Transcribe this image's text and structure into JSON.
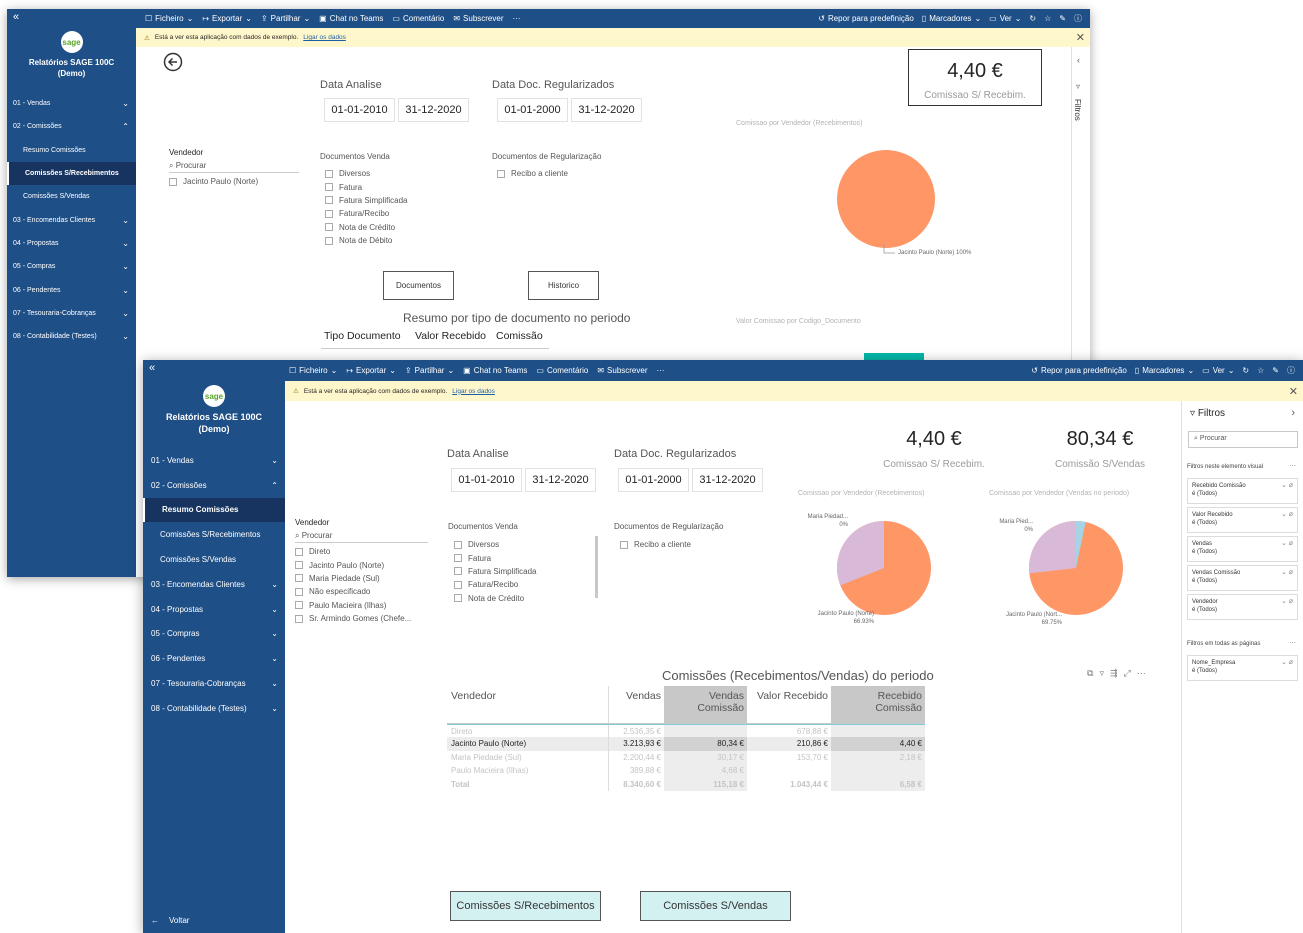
{
  "topbar": {
    "items": [
      "Ficheiro",
      "Exportar",
      "Partilhar",
      "Chat no Teams",
      "Comentário",
      "Subscrever",
      "···"
    ],
    "right": [
      "Repor para predefinição",
      "Marcadores",
      "Ver"
    ]
  },
  "warning": {
    "text": "Está a ver esta aplicação com dados de exemplo.",
    "link": "Ligar os dados"
  },
  "sidebar": {
    "app_title_1": "Relatórios SAGE 100C",
    "app_title_2": "(Demo)",
    "logo": "sage",
    "back": "Voltar",
    "nav": [
      "01 - Vendas",
      "02 - Comissões",
      "Resumo Comissões",
      "Comissões S/Recebimentos",
      "Comissões S/Vendas",
      "03 - Encomendas Clientes",
      "04 - Propostas",
      "05 - Compras",
      "06 - Pendentes",
      "07 - Tesouraria-Cobranças",
      "08 - Contabilidade (Testes)"
    ]
  },
  "win1": {
    "date_analise_label": "Data Analise",
    "date_analise": [
      "01-01-2010",
      "31-12-2020"
    ],
    "date_reg_label": "Data Doc. Regularizados",
    "date_reg": [
      "01-01-2000",
      "31-12-2020"
    ],
    "kpi_value": "4,40 €",
    "kpi_label": "Comissao S/ Recebim.",
    "vendedor_label": "Vendedor",
    "search": "Procurar",
    "vendedores": [
      "Jacinto Paulo (Norte)"
    ],
    "docs_venda_label": "Documentos Venda",
    "docs_venda": [
      "Diversos",
      "Fatura",
      "Fatura Simplificada",
      "Fatura/Recibo",
      "Nota de Crédito",
      "Nota de Débito"
    ],
    "docs_reg_label": "Documentos de Regularização",
    "docs_reg": [
      "Recibo a cliente"
    ],
    "btn_documentos": "Documentos",
    "btn_historico": "Historico",
    "pie_title": "Comissao por Vendedor (Recebimentos)",
    "pie_label": "Jacinto Paulo (Norte) 100%",
    "table_title": "Resumo por tipo de documento no periodo",
    "table_headers": [
      "Tipo Documento",
      "Valor Recebido",
      "Comissão"
    ],
    "chart2_title": "Valor Comissao por Codigo_Documento",
    "filtros_tab": "Filtros",
    "active_nav": "Comissões S/Recebimentos"
  },
  "win2": {
    "active_nav": "Resumo Comissões",
    "date_analise_label": "Data Analise",
    "date_analise": [
      "01-01-2010",
      "31-12-2020"
    ],
    "date_reg_label": "Data Doc. Regularizados",
    "date_reg": [
      "01-01-2000",
      "31-12-2020"
    ],
    "kpi1_value": "4,40 €",
    "kpi1_label": "Comissao S/ Recebim.",
    "kpi2_value": "80,34 €",
    "kpi2_label": "Comissão S/Vendas",
    "vendedor_label": "Vendedor",
    "search": "Procurar",
    "vendedores": [
      "Direto",
      "Jacinto Paulo (Norte)",
      "Maria Piedade (Sul)",
      "Não especificado",
      "Paulo Macieira (Ilhas)",
      "Sr. Armindo Gomes (Chefe..."
    ],
    "docs_venda_label": "Documentos Venda",
    "docs_venda": [
      "Diversos",
      "Fatura",
      "Fatura Simplificada",
      "Fatura/Recibo",
      "Nota de Crédito"
    ],
    "docs_reg_label": "Documentos de Regularização",
    "docs_reg": [
      "Recibo a cliente"
    ],
    "pie1_title": "Comissao por Vendedor (Recebimentos)",
    "pie1_maria": "Maria Piedad...",
    "pie1_maria_pct": "0%",
    "pie1_jacinto": "Jacinto Paulo (Norte)",
    "pie1_jacinto_pct": "66.93%",
    "pie2_title": "Comissao por Vendedor (Vendas no periodo)",
    "pie2_maria": "Maria Pied...",
    "pie2_maria_pct": "0%",
    "pie2_jacinto": "Jacinto Paulo (Nort...",
    "pie2_jacinto_pct": "69.75%",
    "matrix_title": "Comissões (Recebimentos/Vendas) do periodo",
    "matrix_headers": [
      "Vendedor",
      "Vendas",
      "Vendas Comissão",
      "Valor Recebido",
      "Recebido Comissão"
    ],
    "matrix_rows": [
      [
        "Direto",
        "2.536,35 €",
        "",
        "678,88 €",
        ""
      ],
      [
        "Jacinto Paulo (Norte)",
        "3.213,93 €",
        "80,34 €",
        "210,86 €",
        "4,40 €"
      ],
      [
        "Maria Piedade (Sul)",
        "2.200,44 €",
        "30,17 €",
        "153,70 €",
        "2,18 €"
      ],
      [
        "Paulo Macieira (Ilhas)",
        "389,88 €",
        "4,68 €",
        "",
        ""
      ],
      [
        "Total",
        "8.340,60 €",
        "115,18 €",
        "1.043,44 €",
        "6,58 €"
      ]
    ],
    "btn_receb": "Comissões S/Recebimentos",
    "btn_vendas": "Comissões S/Vendas",
    "filters": {
      "title": "Filtros",
      "search": "Procurar",
      "visual_header": "Filtros neste elemento visual",
      "visual_cards": [
        [
          "Recebido Comissão",
          "é (Todos)"
        ],
        [
          "Valor Recebido",
          "é (Todos)"
        ],
        [
          "Vendas",
          "é (Todos)"
        ],
        [
          "Vendas Comissão",
          "é (Todos)"
        ],
        [
          "Vendedor",
          "é (Todos)"
        ]
      ],
      "pages_header": "Filtros em todas as páginas",
      "pages_cards": [
        [
          "Nome_Empresa",
          "é (Todos)"
        ]
      ]
    }
  },
  "colors": {
    "brand": "#1f4f87",
    "pie_orange": "#fe9666",
    "pie_lilac": "#d9b9d8",
    "pie_blue": "#a6d4e6",
    "button_teal": "#d4f1f1"
  }
}
